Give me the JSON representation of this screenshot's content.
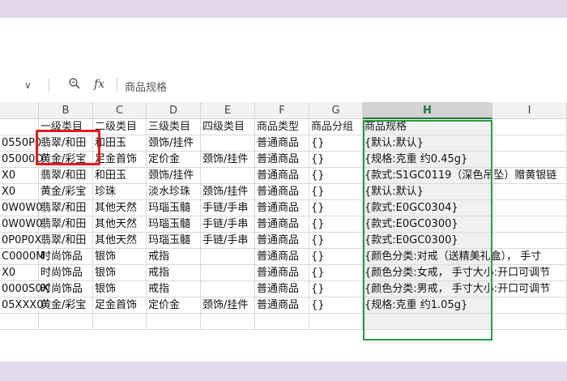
{
  "formula_bar": {
    "chevron": "∨",
    "zoom_icon": "magnifier-icon",
    "fx_label": "fx",
    "value": "商品规格"
  },
  "columns": [
    "B",
    "C",
    "D",
    "E",
    "F",
    "G",
    "H",
    "I"
  ],
  "selected_column": "H",
  "rows": [
    [
      "",
      "一级类目",
      "二级类目",
      "三级类目",
      "四级类目",
      "商品类型",
      "商品分组",
      "商品规格",
      ""
    ],
    [
      "0550P0",
      "翡翠/和田",
      "和田玉",
      "颈饰/挂件",
      "",
      "普通商品",
      "{}",
      "{默认:默认}",
      ""
    ],
    [
      "05000D",
      "黄金/彩宝",
      "足金首饰",
      "定价金",
      "颈饰/挂件",
      "普通商品",
      "{}",
      "{规格:克重 约0.45g}",
      ""
    ],
    [
      "X0",
      "翡翠/和田",
      "和田玉",
      "颈饰/挂件",
      "",
      "普通商品",
      "{}",
      "{款式:S1GC0119（深色吊坠）赠黄银链",
      ""
    ],
    [
      "X0",
      "黄金/彩宝",
      "珍珠",
      "淡水珍珠",
      "颈饰/挂件",
      "普通商品",
      "{}",
      "{默认:默认}",
      ""
    ],
    [
      "0W0W0",
      "翡翠/和田",
      "其他天然",
      "玛瑙玉髓",
      "手链/手串",
      "普通商品",
      "{}",
      "{款式:E0GC0304}",
      ""
    ],
    [
      "0W0W0",
      "翡翠/和田",
      "其他天然",
      "玛瑙玉髓",
      "手链/手串",
      "普通商品",
      "{}",
      "{款式:E0GC0300}",
      ""
    ],
    [
      "0P0P0X",
      "翡翠/和田",
      "其他天然",
      "玛瑙玉髓",
      "手链/手串",
      "普通商品",
      "{}",
      "{款式:E0GC0300}",
      ""
    ],
    [
      "C0000M",
      "时尚饰品",
      "银饰",
      "戒指",
      "",
      "普通商品",
      "{}",
      "{颜色分类:对戒（送精美礼盒）， 手寸",
      ""
    ],
    [
      "X0",
      "时尚饰品",
      "银饰",
      "戒指",
      "",
      "普通商品",
      "{}",
      "{颜色分类:女戒， 手寸大小:开口可调节",
      ""
    ],
    [
      "0000S0X",
      "时尚饰品",
      "银饰",
      "戒指",
      "",
      "普通商品",
      "{}",
      "{颜色分类:男戒， 手寸大小:开口可调节",
      ""
    ],
    [
      "05XXX0",
      "黄金/彩宝",
      "足金首饰",
      "定价金",
      "颈饰/挂件",
      "普通商品",
      "{}",
      "{规格:克重 约1.05g}",
      ""
    ],
    [
      "",
      "",
      "",
      "",
      "",
      "",
      "",
      "",
      ""
    ]
  ]
}
